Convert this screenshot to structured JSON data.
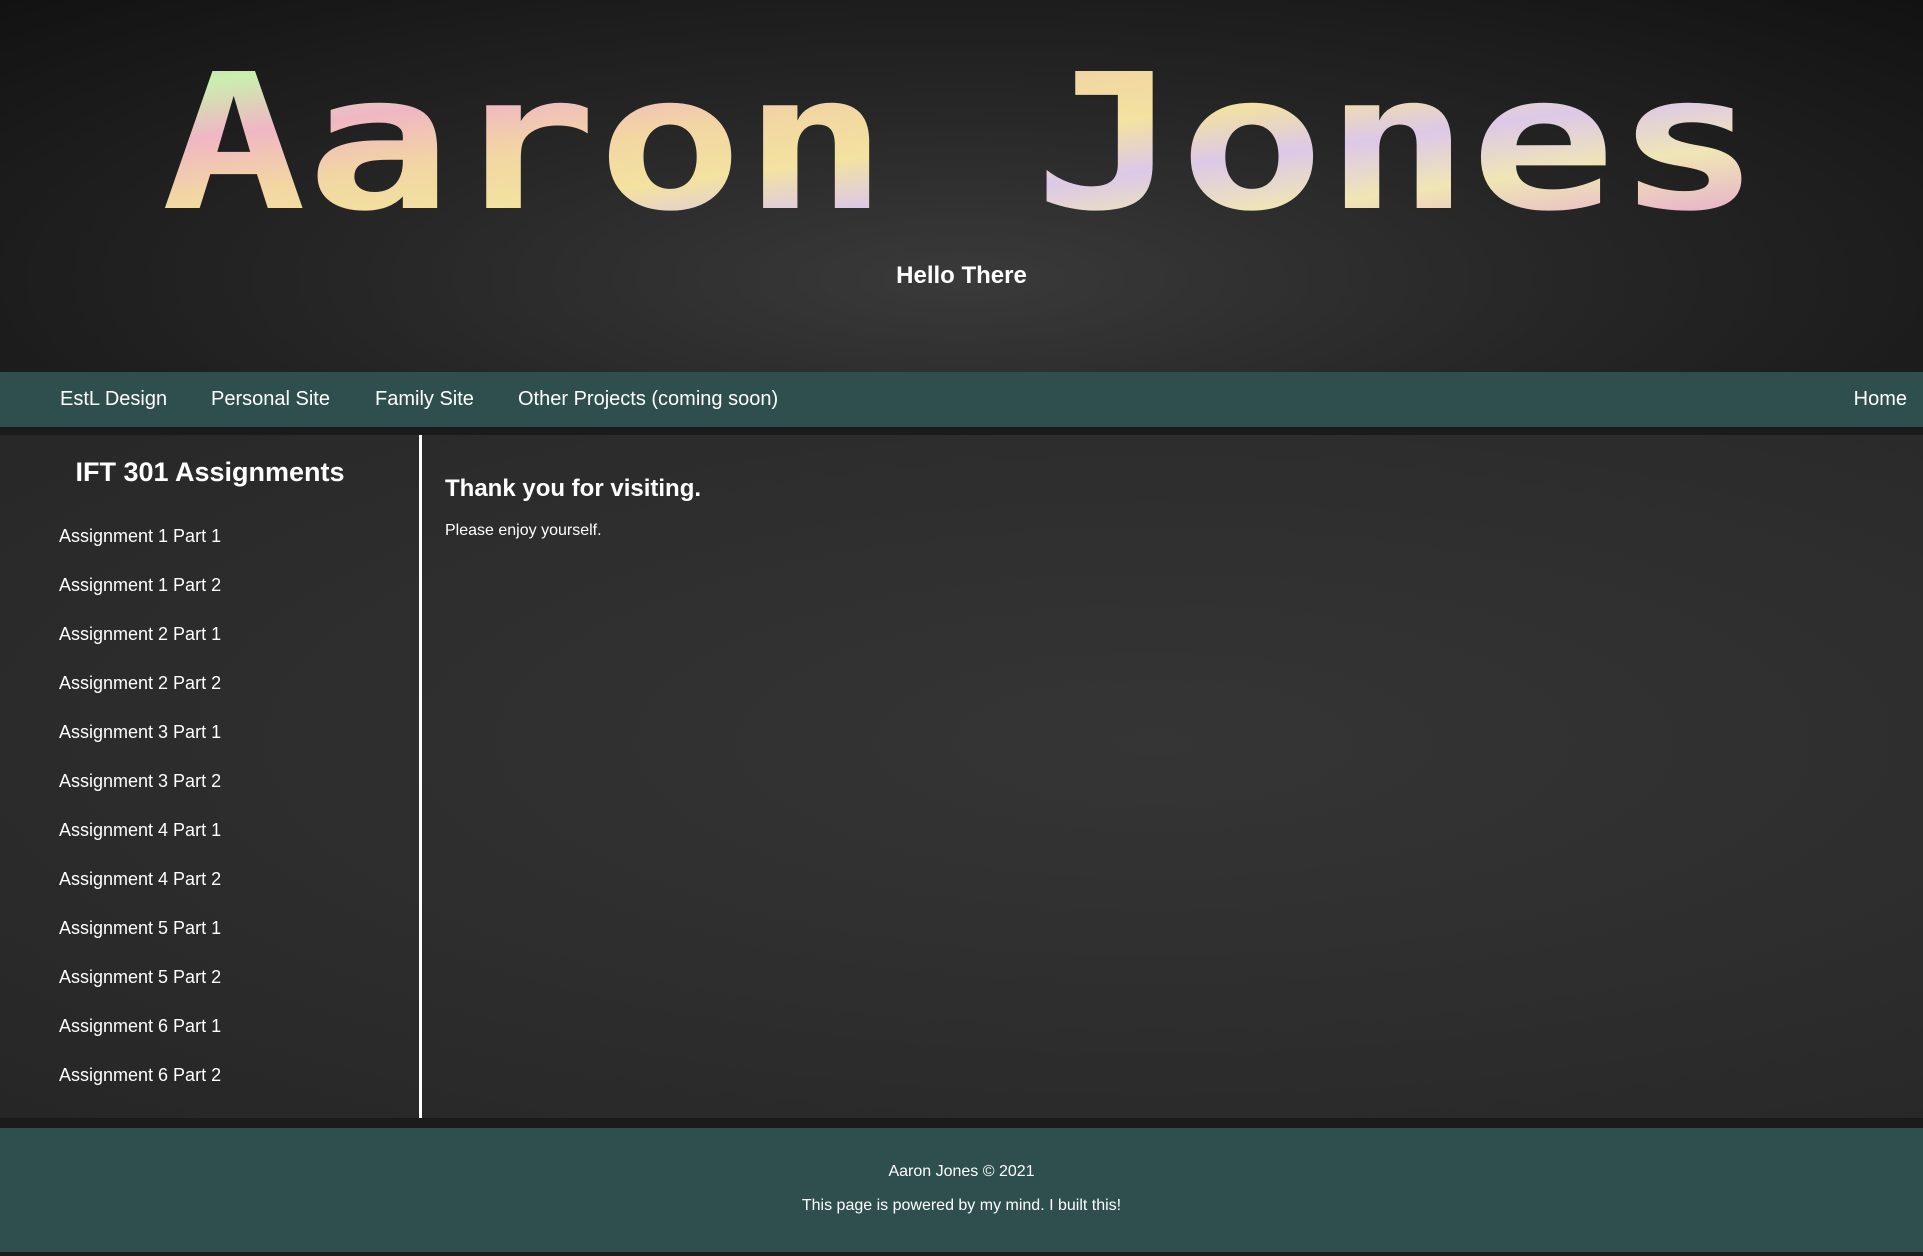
{
  "header": {
    "logo_text": "Aaron Jones",
    "tagline": "Hello There"
  },
  "nav": {
    "links": [
      "EstL Design",
      "Personal Site",
      "Family Site",
      "Other Projects (coming soon)"
    ],
    "home": "Home"
  },
  "sidebar": {
    "title": "IFT 301 Assignments",
    "items": [
      "Assignment 1 Part 1",
      "Assignment 1 Part 2",
      "Assignment 2 Part 1",
      "Assignment 2 Part 2",
      "Assignment 3 Part 1",
      "Assignment 3 Part 2",
      "Assignment 4 Part 1",
      "Assignment 4 Part 2",
      "Assignment 5 Part 1",
      "Assignment 5 Part 2",
      "Assignment 6 Part 1",
      "Assignment 6 Part 2"
    ]
  },
  "content": {
    "heading": "Thank you for visiting.",
    "body": "Please enjoy yourself."
  },
  "footer": {
    "copyright": "Aaron Jones © 2021",
    "note": "This page is powered by my mind. I built this!"
  },
  "colors": {
    "nav_bg": "#2f4f4f",
    "footer_bg": "#2f4f4f",
    "text": "#ffffff",
    "page_bg": "#2e2e2e"
  }
}
